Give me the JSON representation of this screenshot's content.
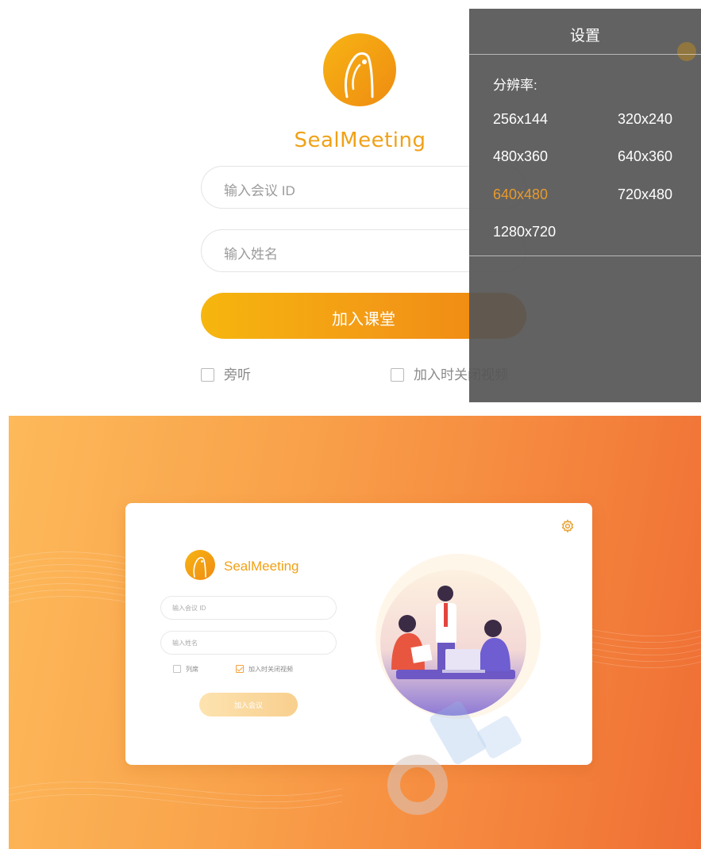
{
  "mobile": {
    "brand": "SealMeeting",
    "meeting_id_placeholder": "输入会议 ID",
    "name_placeholder": "输入姓名",
    "join_button": "加入课堂",
    "listen_only_label": "旁听",
    "close_video_label": "加入时关闭视频",
    "settings": {
      "title": "设置",
      "resolution_label": "分辨率:",
      "resolutions": [
        "256x144",
        "320x240",
        "480x360",
        "640x360",
        "640x480",
        "720x480",
        "1280x720"
      ],
      "selected_resolution": "640x480"
    }
  },
  "desktop": {
    "brand": "SealMeeting",
    "meeting_id_placeholder": "输入会议 ID",
    "name_placeholder": "输入姓名",
    "listen_only_label": "列席",
    "close_video_label": "加入时关闭视频",
    "close_video_checked": true,
    "join_button": "加入会议"
  },
  "colors": {
    "accent": "#f0a116",
    "selected_option": "#e79a2c",
    "panel_bg": "#555555",
    "bg_gradient_start": "#fdb95a",
    "bg_gradient_end": "#ef6e34"
  },
  "icons": {
    "logo": "seal-logo-icon",
    "settings": "gear-icon",
    "watermark": "rongcloud-watermark"
  }
}
